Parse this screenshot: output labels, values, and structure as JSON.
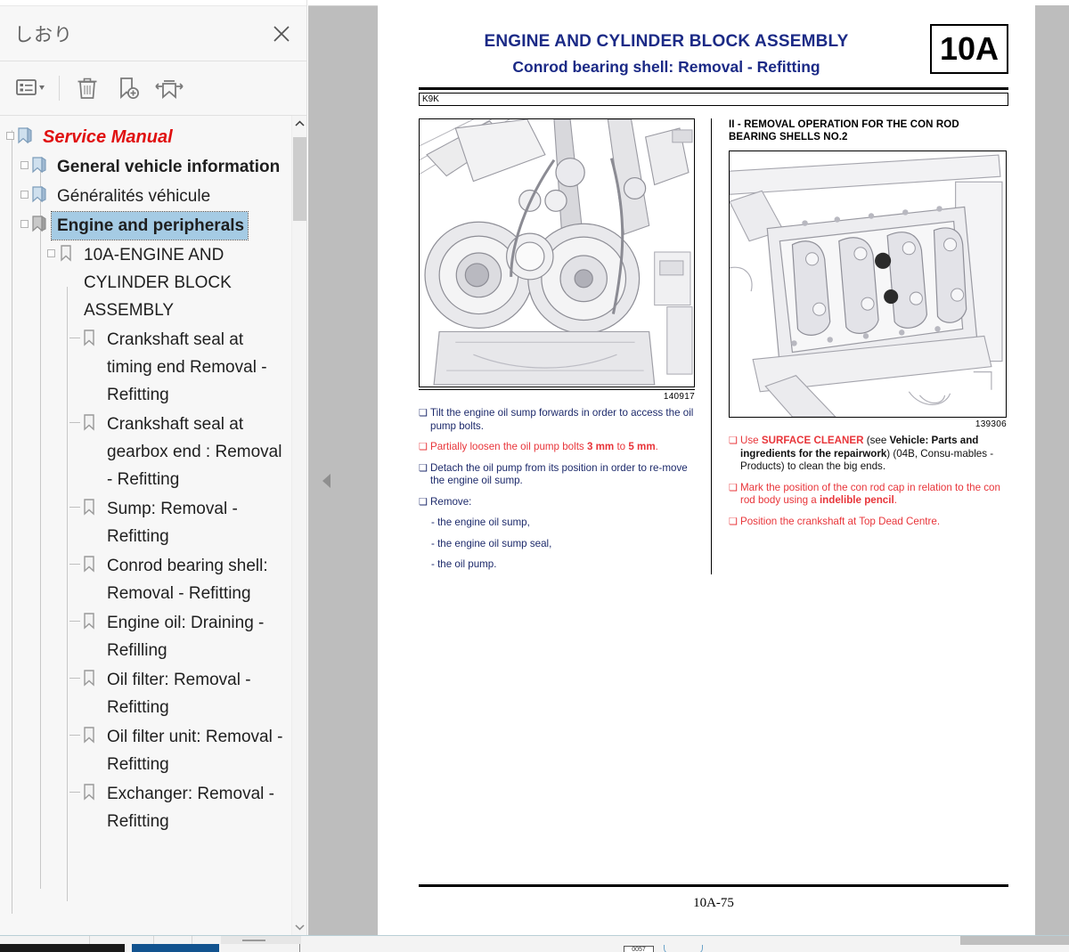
{
  "bookmark_panel": {
    "title": "しおり",
    "close_label": "×",
    "toolbar": [
      {
        "name": "list-options-dropdown",
        "label": "List options"
      },
      {
        "name": "delete-bookmark",
        "label": "Delete"
      },
      {
        "name": "new-bookmark",
        "label": "New bookmark"
      },
      {
        "name": "expand-collapse-bookmarks",
        "label": "Expand current bookmark"
      }
    ],
    "tree": [
      {
        "level": 0,
        "label": "Service Manual",
        "style": "root",
        "expander": true,
        "selected": false
      },
      {
        "level": 1,
        "label": "General vehicle information",
        "style": "bold",
        "expander": true,
        "selected": false
      },
      {
        "level": 1,
        "label": "Généralités véhicule",
        "style": "normal",
        "expander": true,
        "selected": false
      },
      {
        "level": 1,
        "label": "Engine and peripherals",
        "style": "bold",
        "expander": true,
        "selected": true
      },
      {
        "level": 2,
        "label": "10A-ENGINE AND CYLINDER BLOCK ASSEMBLY",
        "style": "normal",
        "expander": true,
        "selected": false
      },
      {
        "level": 3,
        "label": "Crankshaft seal at timing end Removal - Refitting",
        "style": "normal",
        "expander": false,
        "selected": false
      },
      {
        "level": 3,
        "label": "Crankshaft seal at gearbox end : Removal - Refitting",
        "style": "normal",
        "expander": false,
        "selected": false
      },
      {
        "level": 3,
        "label": "Sump: Removal - Refitting",
        "style": "normal",
        "expander": false,
        "selected": false
      },
      {
        "level": 3,
        "label": "Conrod bearing shell: Removal - Refitting",
        "style": "normal",
        "expander": false,
        "selected": false
      },
      {
        "level": 3,
        "label": "Engine oil: Draining - Refilling",
        "style": "normal",
        "expander": false,
        "selected": false
      },
      {
        "level": 3,
        "label": "Oil filter: Removal - Refitting",
        "style": "normal",
        "expander": false,
        "selected": false
      },
      {
        "level": 3,
        "label": "Oil filter unit: Removal - Refitting",
        "style": "normal",
        "expander": false,
        "selected": false
      },
      {
        "level": 3,
        "label": "Exchanger: Removal - Refitting",
        "style": "normal",
        "expander": false,
        "selected": false
      }
    ],
    "selected_color": "#a5cbe4",
    "root_color": "#e01010"
  },
  "document": {
    "header": {
      "title_line1": "ENGINE AND CYLINDER BLOCK ASSEMBLY",
      "title_line2": "Conrod bearing shell: Removal - Refitting",
      "chapter_box": "10A",
      "engine_code": "K9K",
      "title_color": "#1b2a86"
    },
    "left_column": {
      "figure_number": "140917",
      "figure_alt": "engine-front-view-illustration",
      "bullets": [
        {
          "marker": "❏",
          "color": "navy",
          "runs": [
            {
              "text": "Tilt the engine oil sump forwards in order to access the oil pump bolts.",
              "bold": false,
              "color": "navy"
            }
          ]
        },
        {
          "marker": "❏",
          "color": "red",
          "runs": [
            {
              "text": "Partially loosen the oil pump bolts ",
              "bold": false,
              "color": "red"
            },
            {
              "text": "3 mm",
              "bold": true,
              "color": "red"
            },
            {
              "text": " to ",
              "bold": false,
              "color": "red"
            },
            {
              "text": "5 mm",
              "bold": true,
              "color": "red"
            },
            {
              "text": ".",
              "bold": false,
              "color": "red"
            }
          ]
        },
        {
          "marker": "❏",
          "color": "navy",
          "runs": [
            {
              "text": "Detach the oil pump from its position in order to re-move the engine oil sump.",
              "bold": false,
              "color": "navy"
            }
          ]
        },
        {
          "marker": "❏",
          "color": "navy",
          "runs": [
            {
              "text": "Remove:",
              "bold": false,
              "color": "navy"
            }
          ]
        }
      ],
      "sub_items": [
        "- the engine oil sump,",
        "- the engine oil sump seal,",
        "- the oil pump."
      ]
    },
    "right_column": {
      "section_heading": "II - REMOVAL OPERATION FOR THE CON ROD BEARING SHELLS NO.2",
      "figure_number": "139306",
      "figure_alt": "crankshaft-con-rod-bearing-illustration",
      "bullets": [
        {
          "marker": "❏",
          "color": "red",
          "runs": [
            {
              "text": "Use ",
              "bold": false,
              "color": "red"
            },
            {
              "text": "SURFACE CLEANER",
              "bold": true,
              "color": "red"
            },
            {
              "text": "  (see ",
              "bold": false,
              "color": "black"
            },
            {
              "text": "Vehicle: Parts and ingredients for the repairwork",
              "bold": true,
              "color": "black"
            },
            {
              "text": ") (04B, Consu-mables - Products) to clean the big ends.",
              "bold": false,
              "color": "black"
            }
          ]
        },
        {
          "marker": "❏",
          "color": "red",
          "runs": [
            {
              "text": "Mark the position of the con rod cap in relation to the con rod body using a ",
              "bold": false,
              "color": "red"
            },
            {
              "text": "indelible pencil",
              "bold": true,
              "color": "red"
            },
            {
              "text": ".",
              "bold": false,
              "color": "red"
            }
          ]
        },
        {
          "marker": "❏",
          "color": "red",
          "runs": [
            {
              "text": "Position the crankshaft at Top Dead Centre.",
              "bold": false,
              "color": "red"
            }
          ]
        }
      ]
    },
    "footer": {
      "page_number": "10A-75"
    }
  },
  "taskbar": {
    "cell_label": "0057"
  }
}
